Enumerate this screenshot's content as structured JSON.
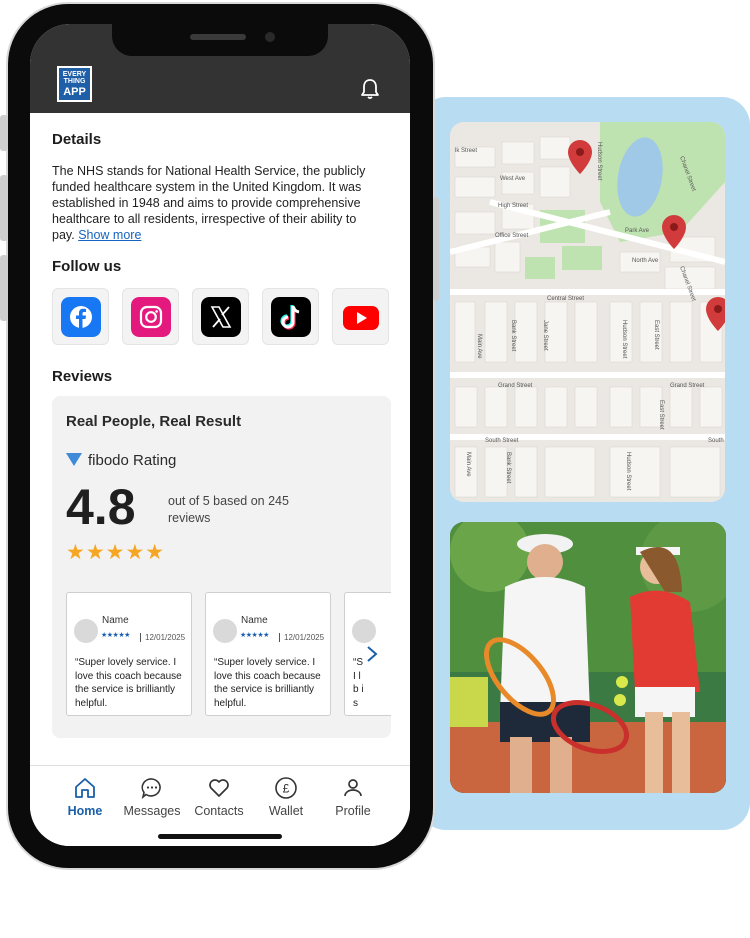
{
  "app": {
    "logo_line1": "EVERY",
    "logo_line2": "THING",
    "logo_line3": "APP"
  },
  "details": {
    "title": "Details",
    "text": "The NHS stands for National Health Service, the publicly funded healthcare system in the United Kingdom. It was established in 1948 and aims to provide comprehensive healthcare to all residents, irrespective of their ability to pay.",
    "show_more": "Show more"
  },
  "follow": {
    "title": "Follow us",
    "icons": [
      "facebook-icon",
      "instagram-icon",
      "x-icon",
      "tiktok-icon",
      "youtube-icon"
    ]
  },
  "reviews": {
    "title": "Reviews",
    "box_title": "Real People, Real Result",
    "rating_source": "fibodo Rating",
    "score": "4.8",
    "score_sub": "out of 5 based on 245 reviews",
    "star_count": 5,
    "cards": [
      {
        "name": "Name",
        "date": "12/01/2025",
        "text": "“Super lovely service. I love this coach because the service is brilliantly helpful."
      },
      {
        "name": "Name",
        "date": "12/01/2025",
        "text": "“Super lovely service. I love this coach because the service is brilliantly helpful."
      },
      {
        "name": "",
        "date": "",
        "text": "“S I l b is"
      }
    ]
  },
  "tabs": [
    {
      "label": "Home",
      "active": true
    },
    {
      "label": "Messages",
      "active": false
    },
    {
      "label": "Contacts",
      "active": false
    },
    {
      "label": "Wallet",
      "active": false
    },
    {
      "label": "Profile",
      "active": false
    }
  ],
  "map": {
    "streets": [
      "Hudson Street",
      "Park Ave",
      "Chanel Street",
      "West Ave",
      "High Street",
      "Office Street",
      "North Ave",
      "Central Street",
      "Main Ave",
      "Bank Street",
      "Jane Street",
      "Hudson Street",
      "East Street",
      "Grand Street",
      "Grand Street",
      "East Street",
      "South Street",
      "South",
      "Main Ave",
      "Bank Street",
      "Hudson Street",
      "Street"
    ]
  },
  "colors": {
    "accent": "#1a5fa8",
    "header": "#333333",
    "panel": "#b8dcf2",
    "star": "#f5a623"
  }
}
